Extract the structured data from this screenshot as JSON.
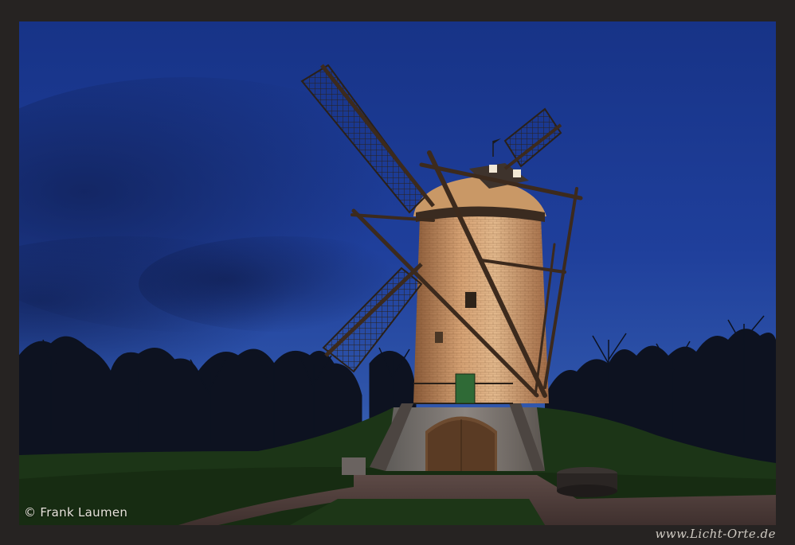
{
  "photo": {
    "subject": "illuminated brick windmill at dusk",
    "colors": {
      "sky_top": "#1d3c97",
      "sky_horizon": "#4a77c4",
      "brick_lit": "#d9a877",
      "grass": "#1f3a18",
      "frame": "#262322"
    }
  },
  "watermark": {
    "credit": "© Frank Laumen",
    "url": "www.Licht-Orte.de"
  }
}
